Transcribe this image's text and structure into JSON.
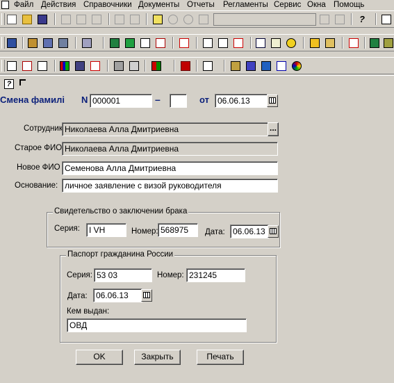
{
  "menu": {
    "items": [
      "Файл",
      "Действия",
      "Справочники",
      "Документы",
      "Отчеты",
      "Регламенты",
      "Сервис",
      "Окна",
      "Помощь"
    ]
  },
  "header": {
    "title": "Смена фамилі",
    "number_label": "N",
    "number_value": "000001",
    "dash": "–",
    "date_from_label": "от",
    "date_value": "06.06.13"
  },
  "employee": {
    "employee_label": "Сотрудник",
    "employee_value": "Николаева Алла Дмитриевна",
    "old_name_label": "Старое ФИО",
    "old_name_value": "Николаева Алла Дмитриевна",
    "new_name_label": "Новое ФИО",
    "new_name_value": "Семенова Алла Дмитриевна",
    "basis_label": "Основание:",
    "basis_value": "личное заявление с визой руководителя",
    "select_button": "..."
  },
  "marriage_certificate": {
    "title": "Свидетельство о заключении брака",
    "series_label": "Серия:",
    "series_value": "I VH",
    "number_label": "Номер:",
    "number_value": "568975",
    "date_label": "Дата:",
    "date_value": "06.06.13"
  },
  "passport": {
    "title": "Паспорт гражданина России",
    "series_label": "Серия:",
    "series_value": "53 03",
    "number_label": "Номер:",
    "number_value": "231245",
    "date_label": "Дата:",
    "date_value": "06.06.13",
    "issued_by_label": "Кем выдан:",
    "issued_by_value": "ОВД"
  },
  "buttons": {
    "ok": "OK",
    "close": "Закрыть",
    "print": "Печать"
  },
  "toolbar": {
    "help_glyph": "?"
  }
}
